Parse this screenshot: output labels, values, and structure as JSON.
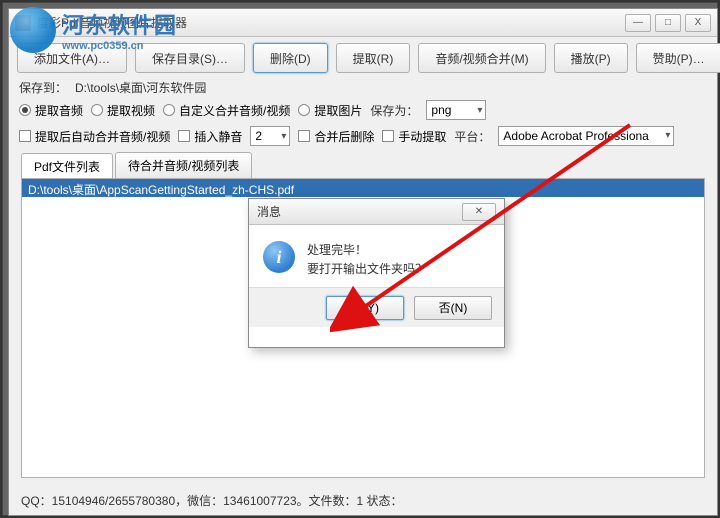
{
  "window": {
    "title": "度彩Pdf音频视频图片提取器"
  },
  "watermark": {
    "name": "河东软件园",
    "url": "www.pc0359.cn"
  },
  "toolbar": {
    "add_file": "添加文件(A)…",
    "save_dir": "保存目录(S)…",
    "delete": "删除(D)",
    "extract": "提取(R)",
    "av_merge": "音频/视频合并(M)",
    "play": "播放(P)",
    "sponsor": "赞助(P)…"
  },
  "row2": {
    "save_to_label": "保存到：",
    "save_to_path": "D:\\tools\\桌面\\河东软件园",
    "radio_audio": "提取音频",
    "radio_video": "提取视频",
    "radio_custom": "自定义合并音频/视频",
    "radio_image": "提取图片",
    "save_as_label": "保存为：",
    "save_as_value": "png"
  },
  "row3": {
    "chk_auto_merge": "提取后自动合并音频/视频",
    "chk_insert_silence": "插入静音",
    "spin_value": "2",
    "chk_delete_after": "合并后删除",
    "chk_manual": "手动提取",
    "platform_label": "平台：",
    "platform_value": "Adobe Acrobat Professiona"
  },
  "tabs": {
    "tab1": "Pdf文件列表",
    "tab2": "待合并音频/视频列表"
  },
  "list": {
    "row1": "D:\\tools\\桌面\\AppScanGettingStarted_zh-CHS.pdf"
  },
  "dialog": {
    "title": "消息",
    "line1": "处理完毕！",
    "line2": "要打开输出文件夹吗？",
    "yes": "是(Y)",
    "no": "否(N)"
  },
  "statusbar": {
    "text": "QQ：15104946/2655780380，微信：13461007723。文件数：1  状态："
  }
}
